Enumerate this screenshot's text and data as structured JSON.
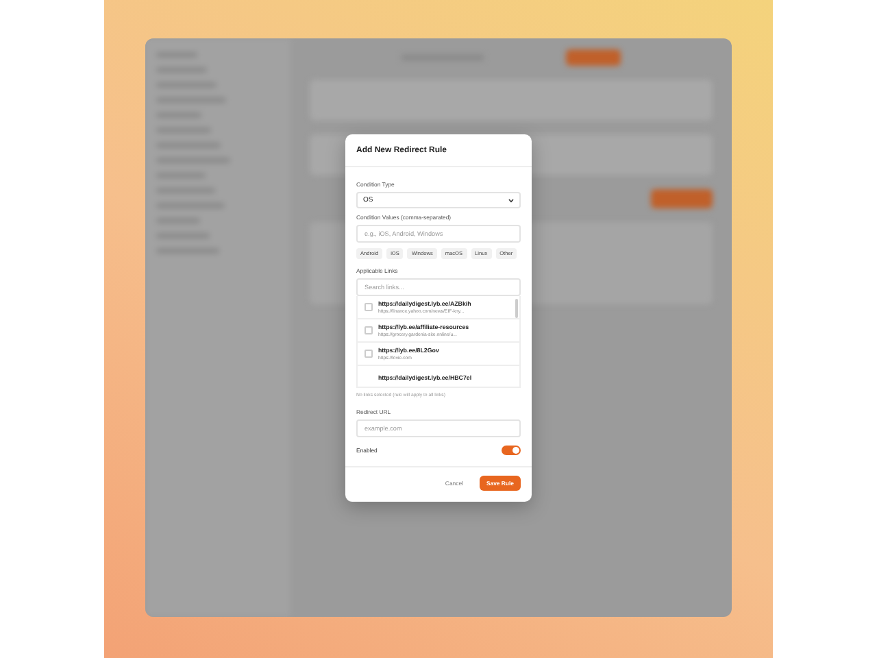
{
  "dialog": {
    "title": "Add New Redirect Rule",
    "condition_type": {
      "label": "Condition Type",
      "value": "OS"
    },
    "condition_values": {
      "label": "Condition Values (comma-separated)",
      "placeholder": "e.g., iOS, Android, Windows",
      "chips": [
        "Android",
        "iOS",
        "Windows",
        "macOS",
        "Linux",
        "Other"
      ]
    },
    "applicable_links": {
      "label": "Applicable Links",
      "placeholder": "Search links...",
      "links": [
        {
          "url": "https://dailydigest.lyb.ee/AZBkih",
          "target": "https://finance.yahoo.com/news/EIF-kny...",
          "checked": false
        },
        {
          "url": "https://lyb.ee/affiliate-resources",
          "target": "https://grocery.gardenia-site.online/u...",
          "checked": false
        },
        {
          "url": "https://lyb.ee/8L2Gov",
          "target": "https://lovie.com",
          "checked": false
        },
        {
          "url": "https://dailydigest.lyb.ee/HBC7el"
        }
      ],
      "note": "No links selected (rule will apply to all links)"
    },
    "redirect_url": {
      "label": "Redirect URL",
      "placeholder": "example.com"
    },
    "enabled": {
      "label": "Enabled",
      "on": true
    },
    "buttons": {
      "cancel": "Cancel",
      "save": "Save Rule"
    }
  }
}
